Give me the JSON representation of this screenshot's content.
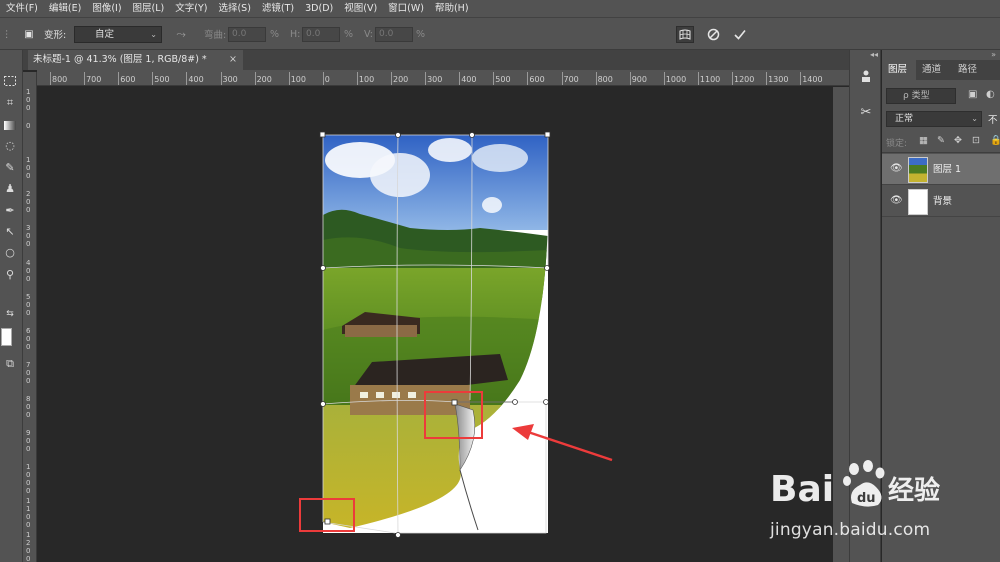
{
  "menu": [
    "文件(F)",
    "编辑(E)",
    "图像(I)",
    "图层(L)",
    "文字(Y)",
    "选择(S)",
    "滤镜(T)",
    "3D(D)",
    "视图(V)",
    "窗口(W)",
    "帮助(H)"
  ],
  "options": {
    "transform_label": "变形:",
    "preset_value": "自定",
    "bend_label": "弯曲:",
    "bend_value": "0.0",
    "h_label": "H:",
    "h_value": "0.0",
    "v_label": "V:",
    "v_value": "0.0",
    "percent": "%"
  },
  "document_tab": {
    "title": "未标题-1 @ 41.3% (图层 1, RGB/8#) *",
    "close": "×"
  },
  "ruler": {
    "h_ticks": [
      "800",
      "700",
      "600",
      "500",
      "400",
      "300",
      "200",
      "100",
      "0",
      "100",
      "200",
      "300",
      "400",
      "500",
      "600",
      "700",
      "800",
      "900",
      "1000",
      "1100",
      "1200",
      "1300",
      "1400"
    ],
    "v_ticks": [
      "1\n0\n0",
      "0",
      "1\n0\n0",
      "2\n0\n0",
      "3\n0\n0",
      "4\n0\n0",
      "5\n0\n0",
      "6\n0\n0",
      "7\n0\n0",
      "8\n0\n0",
      "9\n0\n0",
      "1\n0\n0\n0",
      "1\n1\n0\n0",
      "1\n2\n0\n0"
    ]
  },
  "layers_panel": {
    "tabs": [
      "图层",
      "通道",
      "路径"
    ],
    "filter_placeholder": "ρ 类型",
    "blend_mode": "正常",
    "opacity_label": "不",
    "lock_label": "锁定:",
    "layers": [
      {
        "name": "图层 1",
        "selected": true
      },
      {
        "name": "背景",
        "selected": false
      }
    ]
  },
  "watermark": {
    "brand": "Bai",
    "brand2": "经验",
    "url": "jingyan.baidu.com"
  },
  "colors": {
    "annotation_red": "#ec3b3b",
    "panel_bg": "#535353",
    "canvas_bg": "#282828"
  }
}
